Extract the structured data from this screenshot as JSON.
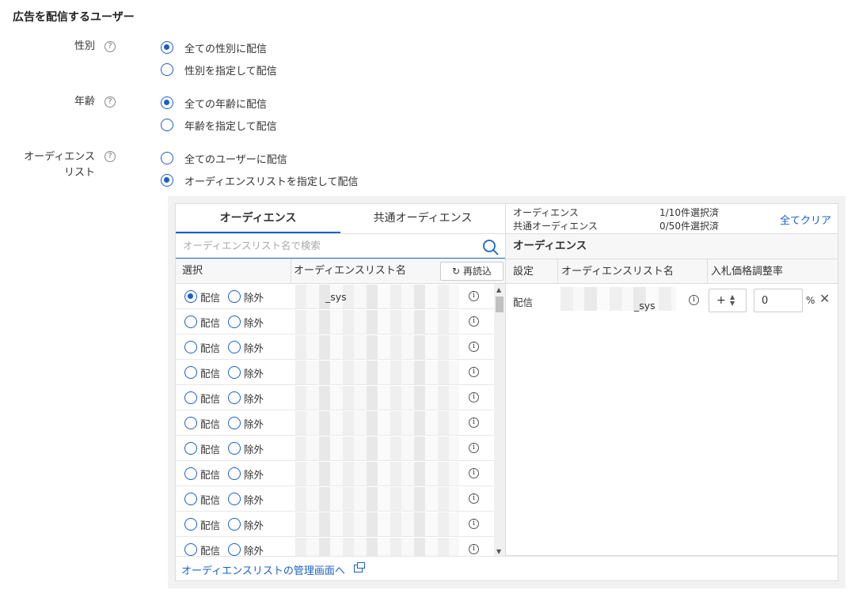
{
  "section_title": "広告を配信するユーザー",
  "gender": {
    "label": "性別",
    "options": [
      "全ての性別に配信",
      "性別を指定して配信"
    ],
    "selected": 0
  },
  "age": {
    "label": "年齢",
    "options": [
      "全ての年齢に配信",
      "年齢を指定して配信"
    ],
    "selected": 0
  },
  "audience": {
    "label_line1": "オーディエンス",
    "label_line2": "リスト",
    "options": [
      "全てのユーザーに配信",
      "オーディエンスリストを指定して配信"
    ],
    "selected": 1
  },
  "help_glyph": "?",
  "left_panel": {
    "tabs": [
      "オーディエンス",
      "共通オーディエンス"
    ],
    "active_tab": 0,
    "search_placeholder": "オーディエンスリスト名で検索",
    "columns": [
      "選択",
      "オーディエンスリスト名"
    ],
    "reload_label": "再読込",
    "reload_icon": "refresh-icon",
    "option_deliver": "配信",
    "option_exclude": "除外",
    "info_glyph": "i",
    "rows": [
      {
        "name": "_sys",
        "selected": "deliver"
      },
      {
        "name": "",
        "selected": "none"
      },
      {
        "name": "",
        "selected": "none"
      },
      {
        "name": "",
        "selected": "none"
      },
      {
        "name": "",
        "selected": "none"
      },
      {
        "name": "",
        "selected": "none"
      },
      {
        "name": "",
        "selected": "none"
      },
      {
        "name": "",
        "selected": "none"
      },
      {
        "name": "",
        "selected": "none"
      },
      {
        "name": "",
        "selected": "none"
      },
      {
        "name": "",
        "selected": "none"
      }
    ]
  },
  "right_panel": {
    "summary": [
      {
        "label": "オーディエンス",
        "count": "1/10件選択済"
      },
      {
        "label": "共通オーディエンス",
        "count": "0/50件選択済"
      }
    ],
    "clear_all": "全てクリア",
    "subtitle": "オーディエンス",
    "columns": [
      "設定",
      "オーディエンスリスト名",
      "入札価格調整率"
    ],
    "selected_rows": [
      {
        "setting": "配信",
        "name": "_sys",
        "sign": "+",
        "rate": "0",
        "unit": "%"
      }
    ]
  },
  "footer_link": "オーディエンスリストの管理画面へ",
  "colors": {
    "accent": "#1a5fc9"
  }
}
